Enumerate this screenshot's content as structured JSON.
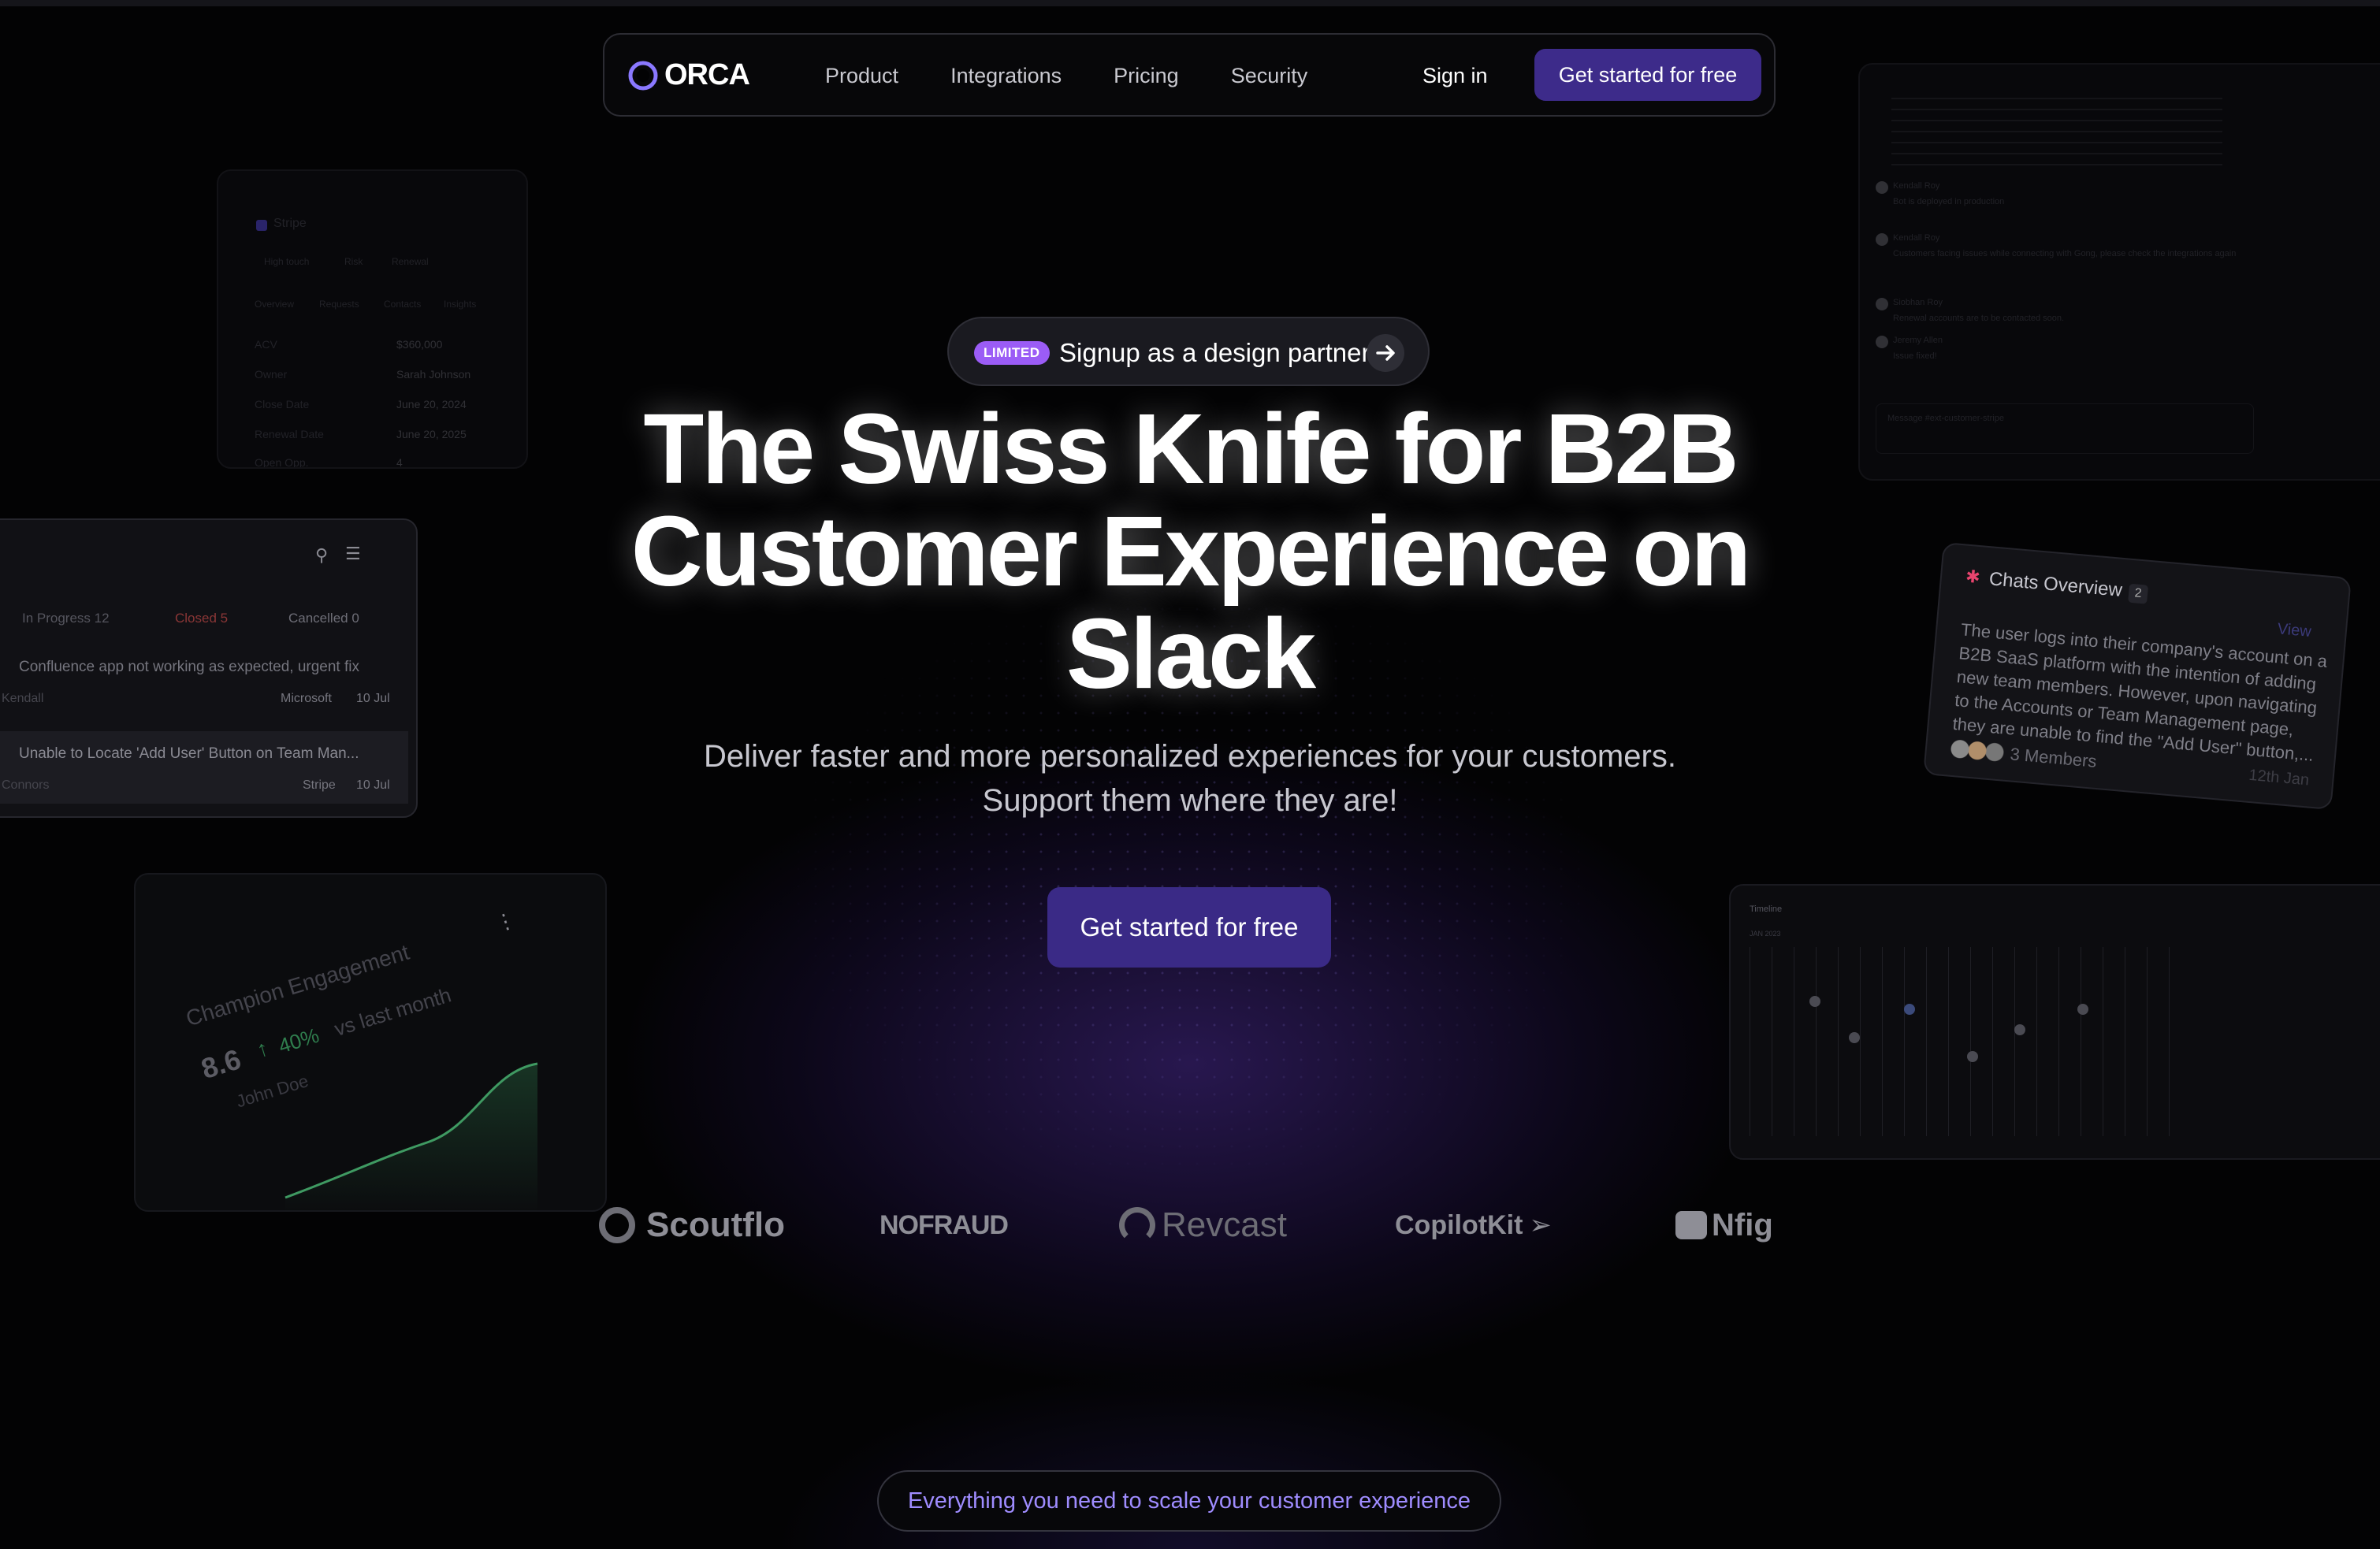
{
  "nav": {
    "brand": "ORCA",
    "links": [
      "Product",
      "Integrations",
      "Pricing",
      "Security"
    ],
    "signin": "Sign in",
    "cta": "Get started for free"
  },
  "hero": {
    "badge_tag": "LIMITED",
    "badge_text": "Signup as a design partner",
    "title": "The Swiss Knife for B2B Customer Experience on Slack",
    "subtitle_line1": "Deliver faster and more personalized experiences for your customers.",
    "subtitle_line2": "Support them where they are!",
    "cta": "Get started for free"
  },
  "logos": [
    "Scoutflo",
    "NOFRAUD",
    "Revcast",
    "CopilotKit",
    "Nfig"
  ],
  "section_pill": "Everything you need to scale your customer experience",
  "cards": {
    "stripe": {
      "title": "Stripe",
      "tags": [
        "High touch",
        "Risk",
        "Renewal"
      ],
      "tabs": [
        "Overview",
        "Requests",
        "Contacts",
        "Insights"
      ],
      "rows": [
        {
          "label": "ACV",
          "value": "$360,000"
        },
        {
          "label": "Owner",
          "value": "Sarah Johnson"
        },
        {
          "label": "Close Date",
          "value": "June 20, 2024"
        },
        {
          "label": "Renewal Date",
          "value": "June 20, 2025"
        },
        {
          "label": "Open Opp.",
          "value": "4"
        }
      ]
    },
    "tickets": {
      "filters": [
        "In Progress 12",
        "Closed 5",
        "Cancelled 0"
      ],
      "items": [
        {
          "title": "Confluence app not working as expected, urgent fix",
          "who": "Kendall",
          "company": "Microsoft",
          "date": "10 Jul"
        },
        {
          "title": "Unable to Locate 'Add User' Button on Team Man...",
          "who": "Connors",
          "company": "Stripe",
          "date": "10 Jul"
        }
      ]
    },
    "engagement": {
      "title": "Champion Engagement",
      "value": "8.6",
      "change": "40%",
      "change_label": "vs last month",
      "person": "John Doe"
    },
    "chats": {
      "title": "Chats Overview",
      "count": "2",
      "view": "View",
      "body": "The user logs into their company's account on a B2B SaaS platform with the intention of adding new team members. However, upon navigating to the Accounts or Team Management page, they are unable to find the \"Add User\" button,...",
      "members": "3 Members",
      "date": "12th Jan"
    },
    "slack": {
      "messages": [
        {
          "name": "Kendall Roy",
          "time": "2:41 PM",
          "text": "Bot is deployed in production"
        },
        {
          "name": "Kendall Roy",
          "time": "3:08 PM",
          "text": "Customers facing issues while connecting with Gong, please check the integrations again"
        },
        {
          "name": "Siobhan Roy",
          "time": "3:10 PM",
          "text": "Renewal accounts are to be contacted soon."
        },
        {
          "name": "Jeremy Allen",
          "time": "3:18 PM",
          "text": "Issue fixed!"
        }
      ],
      "composer": "Message #ext-customer-stripe"
    },
    "timeline": {
      "title": "Timeline",
      "month": "JAN 2023"
    }
  },
  "colors": {
    "background": "#030304",
    "accent": "#3d2b8a",
    "badge": "#9b5cf6",
    "pill_text": "#9f8cff"
  }
}
